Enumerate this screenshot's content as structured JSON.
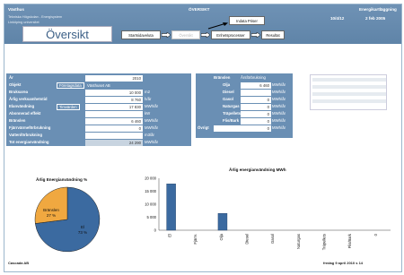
{
  "header": {
    "left_title": "Västhus",
    "center_title": "ÖVERSIKT",
    "right_title": "Energikartläggning",
    "sub1": "Tekniska Högskolan - Energisystem",
    "sub2": "Linköping universitet",
    "version": "10/4/12",
    "date": "2 feb 2005"
  },
  "page_title": "Översikt",
  "nav": {
    "start": "Startsidaveluta",
    "disabled": "Översikt",
    "unit": "Enhetsprocesser",
    "result": "Resultat",
    "indata": "Indata Priser"
  },
  "left_panel": {
    "rows": [
      {
        "label": "År",
        "value": "2010",
        "unit": ""
      },
      {
        "label": "Objekt",
        "value": "Västhuset AB",
        "unit": ""
      },
      {
        "label": "Bruksarea",
        "value": "10 000",
        "unit": "m2"
      },
      {
        "label": "Årlig verksamhetstid",
        "value": "8 760",
        "unit": "h/år"
      },
      {
        "label": "Elanvändning",
        "value": "17 830",
        "unit": "MWh/år"
      },
      {
        "label": "Abonnerad effekt",
        "value": "",
        "unit": "kW"
      },
      {
        "label": "Bränslen",
        "value": "6 460",
        "unit": "MWh/år"
      },
      {
        "label": "Fjärrvärmeförbrukning",
        "value": "0",
        "unit": "MWh/år"
      },
      {
        "label": "Vattenförbrukning",
        "value": "",
        "unit": "m3/år"
      },
      {
        "label": "Tot energianvändning",
        "value": "24 290",
        "unit": "MWh/år"
      }
    ],
    "company_btn": "Företagsdata",
    "hour_btn": "Timvärden"
  },
  "mid_panel": {
    "header_label": "Bränslen",
    "header_value": "Årsförbrukning",
    "rows": [
      {
        "label": "Olja",
        "value": "6 460",
        "unit": "MWh/år"
      },
      {
        "label": "Diesel",
        "value": "",
        "unit": "MWh/år"
      },
      {
        "label": "Gasol",
        "value": "0",
        "unit": "MWh/år"
      },
      {
        "label": "Naturgas",
        "value": "0",
        "unit": "MWh/år"
      },
      {
        "label": "Träpellets",
        "value": "0",
        "unit": "MWh/år"
      },
      {
        "label": "Flis/Bark",
        "value": "0",
        "unit": "MWh/år"
      },
      {
        "label": "Övrigt",
        "value": "0",
        "unit": "MWh/år"
      }
    ]
  },
  "pie": {
    "title": "Årlig Energianvändning %",
    "slices": [
      {
        "label": "El",
        "value": 73,
        "color": "#3b6aa0"
      },
      {
        "label": "Bränslen",
        "value": 27,
        "color": "#f0a840"
      }
    ],
    "labels": [
      "El",
      "73 %",
      "Bränslen",
      "27 %"
    ]
  },
  "chart_data": {
    "type": "bar",
    "title": "Årlig energianvändning MWh",
    "categories": [
      "El",
      "Fjärrv.",
      "Olja",
      "Diesel",
      "Gasol",
      "Naturgas",
      "Träpellets",
      "Flis/Bark",
      "0"
    ],
    "values": [
      17830,
      0,
      6460,
      0,
      0,
      0,
      0,
      0,
      0
    ],
    "ylim": [
      0,
      20000
    ],
    "yticks": [
      "0",
      "5 000",
      "10 000",
      "15 000",
      "20 000"
    ],
    "color": "#3b6aa0"
  },
  "footer": {
    "left": "Cascada AB",
    "right": "fredag 9 april 2010 s 14"
  }
}
